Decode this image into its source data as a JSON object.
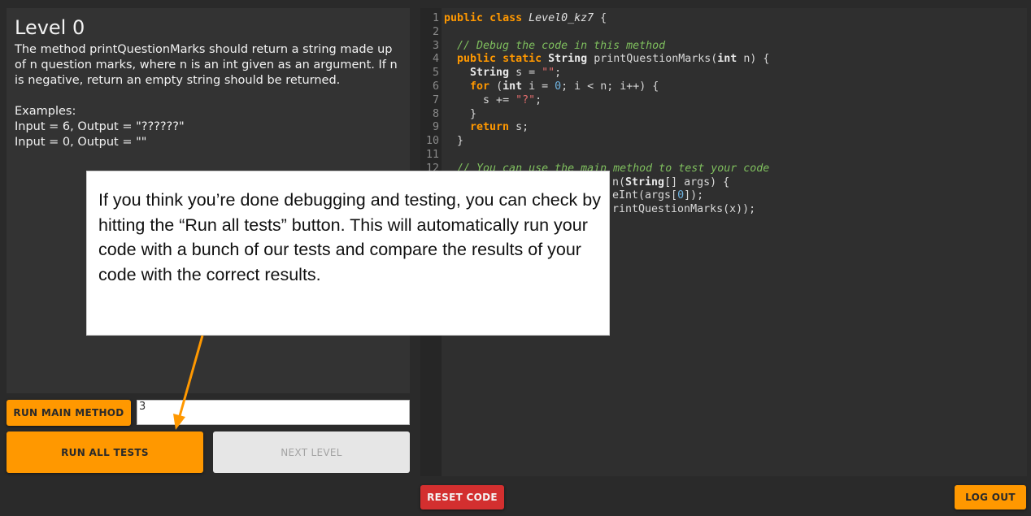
{
  "problem": {
    "title": "Level 0",
    "description": "The method printQuestionMarks should return a string made up of n question marks, where n is an int given as an argument. If n is negative, return an empty string should be returned.",
    "examples_heading": "Examples:",
    "examples": [
      "Input = 6, Output = \"??????\"",
      "Input = 0, Output = \"\""
    ]
  },
  "controls": {
    "run_main_label": "RUN MAIN METHOD",
    "main_input_value": "3",
    "run_all_label": "RUN ALL TESTS",
    "next_level_label": "NEXT LEVEL",
    "reset_label": "RESET CODE",
    "logout_label": "LOG OUT"
  },
  "editor": {
    "line_numbers": [
      "1",
      "2",
      "3",
      "4",
      "5",
      "6",
      "7",
      "8",
      "9",
      "10",
      "11",
      "12"
    ],
    "code": {
      "l1_public": "public",
      "l1_class": "class",
      "l1_name": "Level0_kz7",
      "l1_brace": " {",
      "l3_comment": "// Debug the code in this method",
      "l4_public": "public",
      "l4_static": "static",
      "l4_type": "String",
      "l4_sig": " printQuestionMarks(",
      "l4_int": "int",
      "l4_end": " n) {",
      "l5_type": "String",
      "l5_mid": " s = ",
      "l5_str": "\"\"",
      "l5_end": ";",
      "l6_for": "for",
      "l6_open": " (",
      "l6_int": "int",
      "l6_mid": " i = ",
      "l6_zero": "0",
      "l6_end": "; i < n; i++) {",
      "l7_start": "s += ",
      "l7_str": "\"?\"",
      "l7_end": ";",
      "l8": "}",
      "l9_return": "return",
      "l9_end": " s;",
      "l10": "}",
      "l12_comment": "// You can use the main method to test your code",
      "l13_visible_a": "n(",
      "l13_type": "String",
      "l13_visible_b": "[] args) {",
      "l14_a": "eInt(args[",
      "l14_zero": "0",
      "l14_b": "]);",
      "l15": "rintQuestionMarks(x));"
    }
  },
  "callout": {
    "text": "If you think you’re done debugging and testing, you can check by hitting the “Run all tests” button. This will automatically run your code with a bunch of our tests and compare the results of your code with the correct results."
  },
  "colors": {
    "accent": "#ff9800",
    "danger": "#d32f2f",
    "background": "#2a2a2a",
    "panel": "#333333",
    "editor": "#2f2f2f"
  }
}
